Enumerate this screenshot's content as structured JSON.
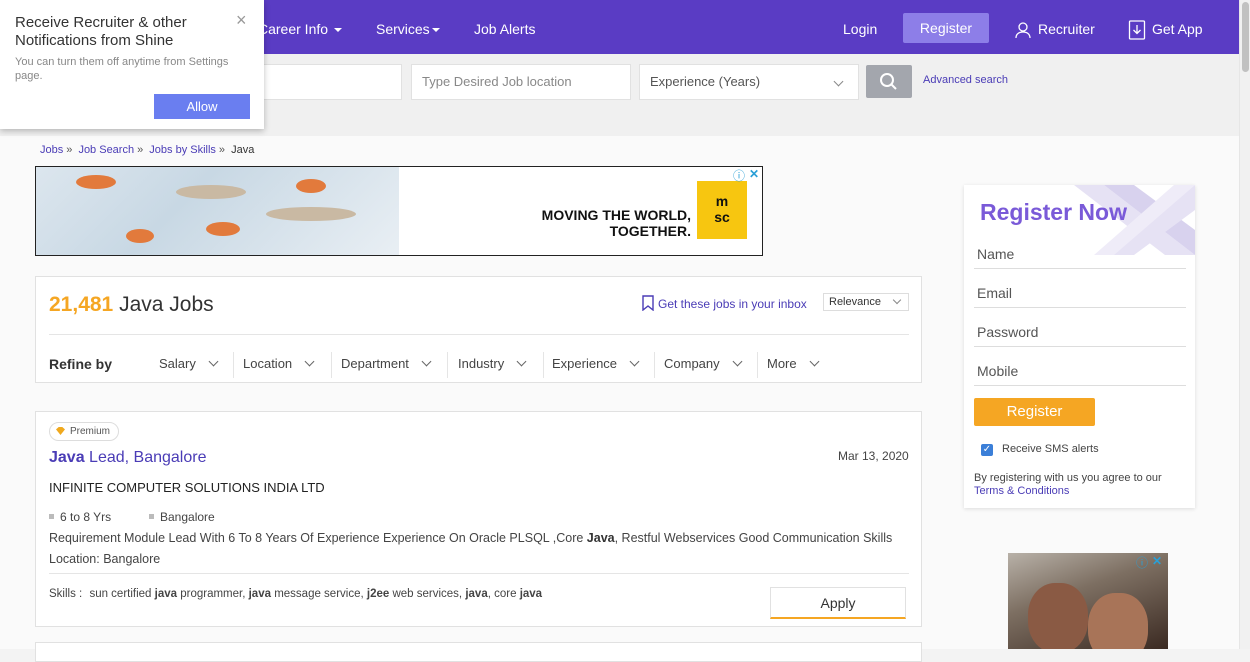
{
  "nav": {
    "career_info": "Career Info",
    "services": "Services",
    "job_alerts": "Job Alerts",
    "login": "Login",
    "register": "Register",
    "recruiter": "Recruiter",
    "get_app": "Get App"
  },
  "search": {
    "location_placeholder": "Type Desired Job location",
    "experience_label": "Experience (Years)",
    "advanced": "Advanced search"
  },
  "popup": {
    "title": "Receive Recruiter & other Notifications from Shine",
    "subtitle": "You can turn them off anytime from Settings page.",
    "close": "×",
    "allow": "Allow"
  },
  "breadcrumbs": [
    "Jobs",
    "Job Search",
    "Jobs by Skills",
    "Java"
  ],
  "ad_banner": {
    "tagline_line1": "MOVING THE WORLD,",
    "tagline_line2": "TOGETHER.",
    "logo_top": "m",
    "logo_bottom": "sc"
  },
  "results": {
    "count": "21,481",
    "label": "Java Jobs",
    "inbox_link": "Get these jobs in your inbox",
    "sort": "Relevance",
    "refine_label": "Refine by",
    "filters": [
      "Salary",
      "Location",
      "Department",
      "Industry",
      "Experience",
      "Company",
      "More"
    ]
  },
  "job": {
    "badge": "Premium",
    "title_bold": "Java",
    "title_rest": " Lead, Bangalore",
    "date": "Mar 13, 2020",
    "company": "INFINITE COMPUTER SOLUTIONS INDIA LTD",
    "experience": "6 to 8 Yrs",
    "location": "Bangalore",
    "desc_part1": "Requirement Module Lead With 6 To 8 Years Of Experience Experience On Oracle PLSQL ,Core ",
    "desc_bold": "Java",
    "desc_part2": ", Restful Webservices Good Communication Skills",
    "desc_line2": "Location: Bangalore",
    "skills_label": "Skills :",
    "skills": [
      {
        "pre": "sun certified ",
        "b": "java",
        "post": " programmer, "
      },
      {
        "pre": "",
        "b": "java",
        "post": " message service, "
      },
      {
        "pre": "",
        "b": "j2ee",
        "post": " web services, "
      },
      {
        "pre": "",
        "b": "java",
        "post": ", core "
      },
      {
        "pre": "",
        "b": "java",
        "post": ""
      }
    ],
    "apply": "Apply"
  },
  "register": {
    "title": "Register Now",
    "name": "Name",
    "email": "Email",
    "password": "Password",
    "mobile": "Mobile",
    "submit": "Register",
    "sms": "Receive SMS alerts",
    "terms_text": "By registering with us you agree to our",
    "terms_link": "Terms & Conditions"
  },
  "colors": {
    "nav": "#5a3cc4",
    "accent_orange": "#f5a623",
    "link_purple": "#4a3cb6",
    "register_title": "#7a5ad8"
  }
}
